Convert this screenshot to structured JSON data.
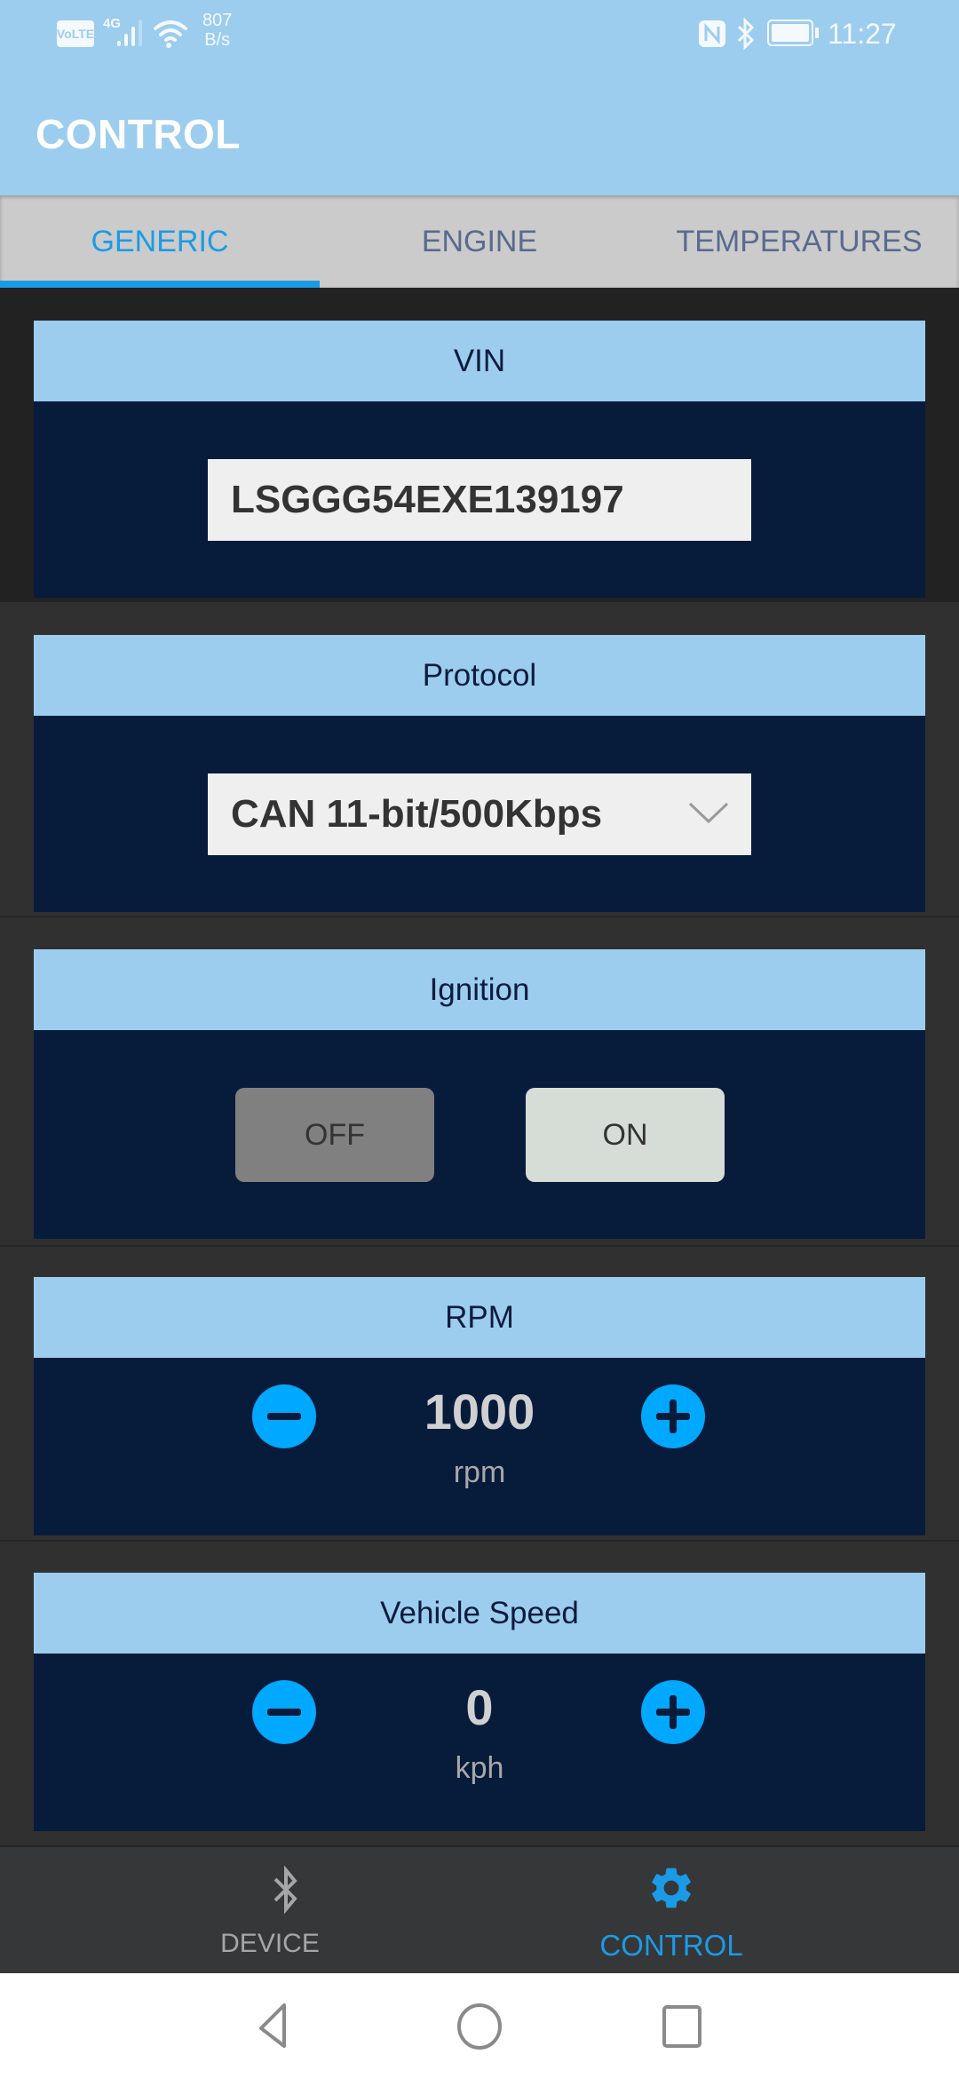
{
  "status_bar": {
    "volte_label": "VoLTE",
    "network_type": "4G",
    "net_speed_value": "807",
    "net_speed_unit": "B/s",
    "time": "11:27",
    "icons": [
      "volte-icon",
      "signal-icon",
      "wifi-icon",
      "nfc-icon",
      "bluetooth-icon",
      "battery-icon"
    ]
  },
  "app_bar": {
    "title": "CONTROL"
  },
  "tabs": [
    {
      "label": "GENERIC",
      "active": true
    },
    {
      "label": "ENGINE",
      "active": false
    },
    {
      "label": "TEMPERATURES",
      "active": false
    }
  ],
  "sections": {
    "vin": {
      "title": "VIN",
      "value": "LSGGG54EXE139197"
    },
    "protocol": {
      "title": "Protocol",
      "selected": "CAN 11-bit/500Kbps"
    },
    "ignition": {
      "title": "Ignition",
      "off_label": "OFF",
      "on_label": "ON",
      "state": "ON"
    },
    "rpm": {
      "title": "RPM",
      "value": "1000",
      "unit": "rpm"
    },
    "speed": {
      "title": "Vehicle Speed",
      "value": "0",
      "unit": "kph"
    }
  },
  "bottom_nav": [
    {
      "label": "DEVICE",
      "icon": "bluetooth-icon",
      "active": false
    },
    {
      "label": "CONTROL",
      "icon": "gear-icon",
      "active": true
    }
  ],
  "system_nav": [
    "back-icon",
    "home-icon",
    "recents-icon"
  ],
  "colors": {
    "accent": "#1b9be6",
    "header_bg": "#9ccdee",
    "card_body": "#071b3b",
    "stepper": "#00a8ff"
  }
}
